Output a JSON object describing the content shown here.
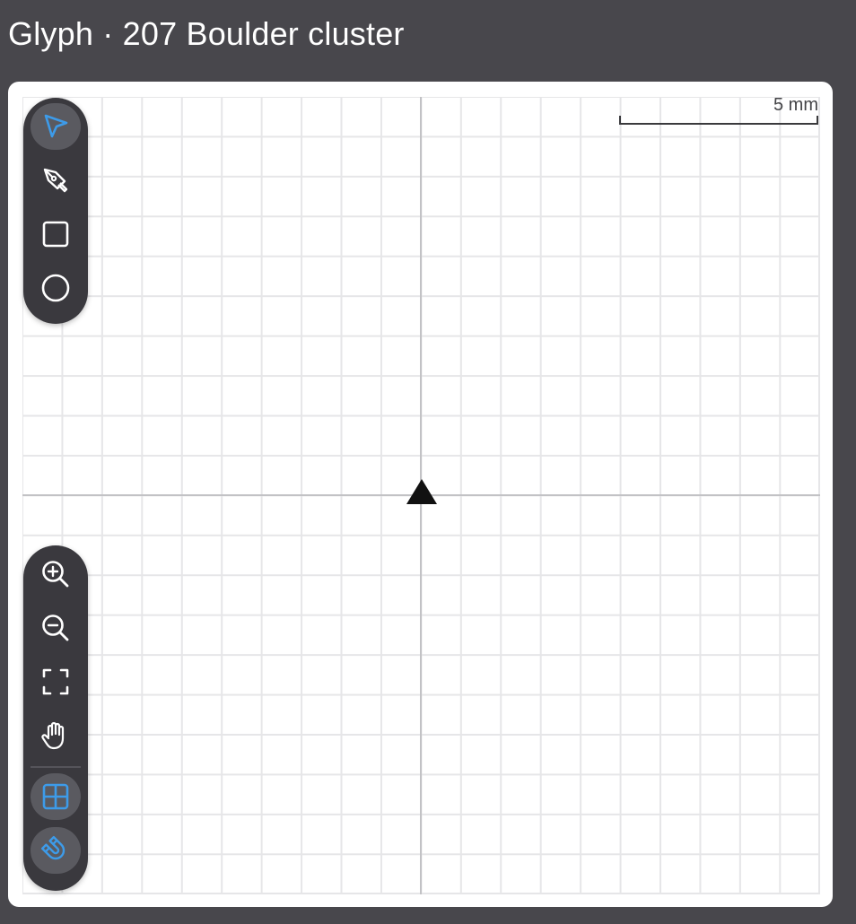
{
  "window": {
    "title": "Glyph · 207 Boulder cluster"
  },
  "canvas": {
    "scale_label": "5 mm"
  },
  "colors": {
    "background": "#48474c",
    "toolbar": "#3a393e",
    "accent": "#3d9be9",
    "grid": "#e6e6e8",
    "axis": "#c2c2c5",
    "marker": "#111111"
  },
  "tools": [
    {
      "name": "select",
      "icon": "cursor-arrow-icon",
      "active": true
    },
    {
      "name": "pen",
      "icon": "pen-nib-icon",
      "active": false
    },
    {
      "name": "rectangle",
      "icon": "square-icon",
      "active": false
    },
    {
      "name": "ellipse",
      "icon": "circle-icon",
      "active": false
    }
  ],
  "view_controls": [
    {
      "name": "zoom-in",
      "icon": "zoom-in-icon"
    },
    {
      "name": "zoom-out",
      "icon": "zoom-out-icon"
    },
    {
      "name": "fit-to-screen",
      "icon": "fullscreen-icon"
    },
    {
      "name": "pan",
      "icon": "hand-icon"
    },
    {
      "name": "grid-toggle",
      "icon": "grid-icon",
      "active": true
    },
    {
      "name": "snap-toggle",
      "icon": "magnet-icon",
      "active": true
    }
  ]
}
